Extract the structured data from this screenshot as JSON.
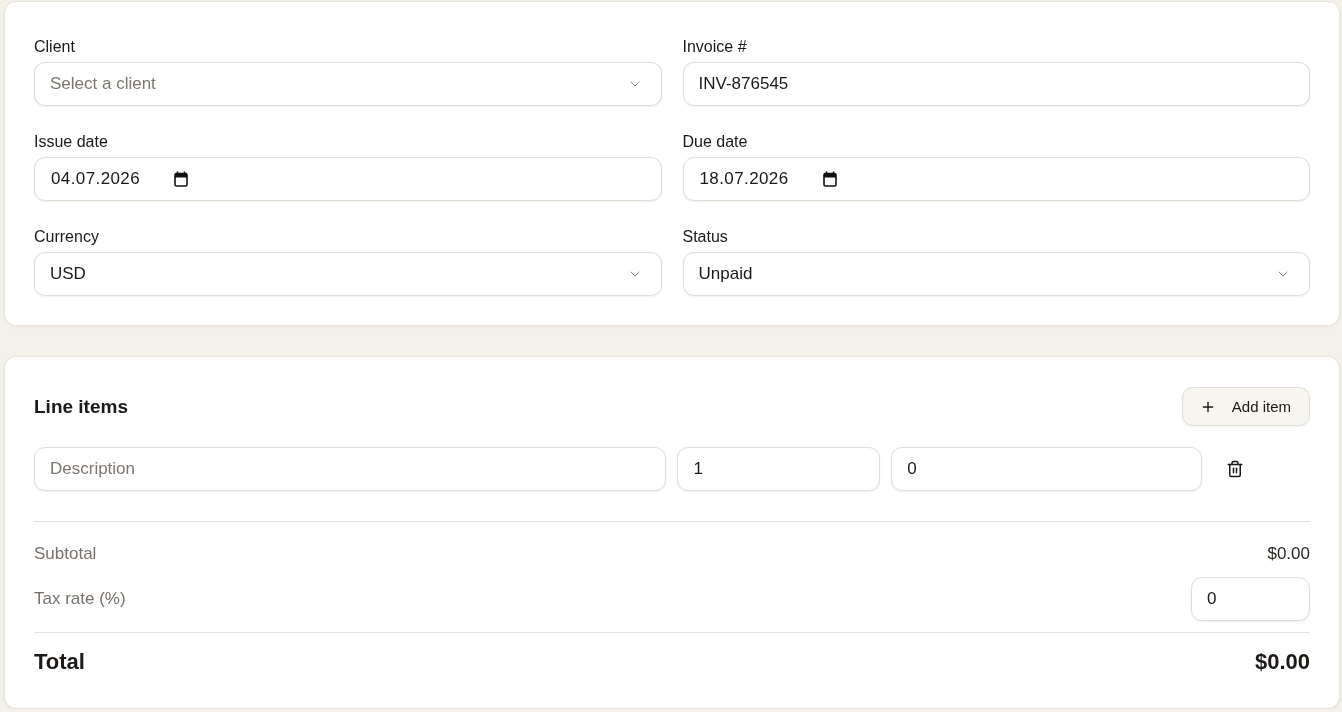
{
  "invoice": {
    "fields": [
      {
        "label": "Client",
        "kind": "select",
        "placeholder": "Select a client"
      },
      {
        "label": "Invoice #",
        "kind": "text",
        "value": "INV-876545"
      },
      {
        "label": "Issue date",
        "kind": "date",
        "value": "04.07.2026"
      },
      {
        "label": "Due date",
        "kind": "date",
        "value": "18.07.2026"
      },
      {
        "label": "Currency",
        "kind": "select",
        "value": "USD"
      },
      {
        "label": "Status",
        "kind": "select",
        "value": "Unpaid"
      }
    ]
  },
  "line_items": {
    "title": "Line items",
    "add_button": "Add item",
    "rows": [
      {
        "fields": [
          {
            "placeholder": "Description"
          },
          {
            "value": "1"
          },
          {
            "value": "0"
          }
        ]
      }
    ]
  },
  "summary": {
    "subtotal": {
      "label": "Subtotal",
      "value": "$0.00"
    },
    "tax_rate": {
      "label": "Tax rate (%)",
      "value": "0"
    },
    "total": {
      "label": "Total",
      "value": "$0.00"
    }
  }
}
